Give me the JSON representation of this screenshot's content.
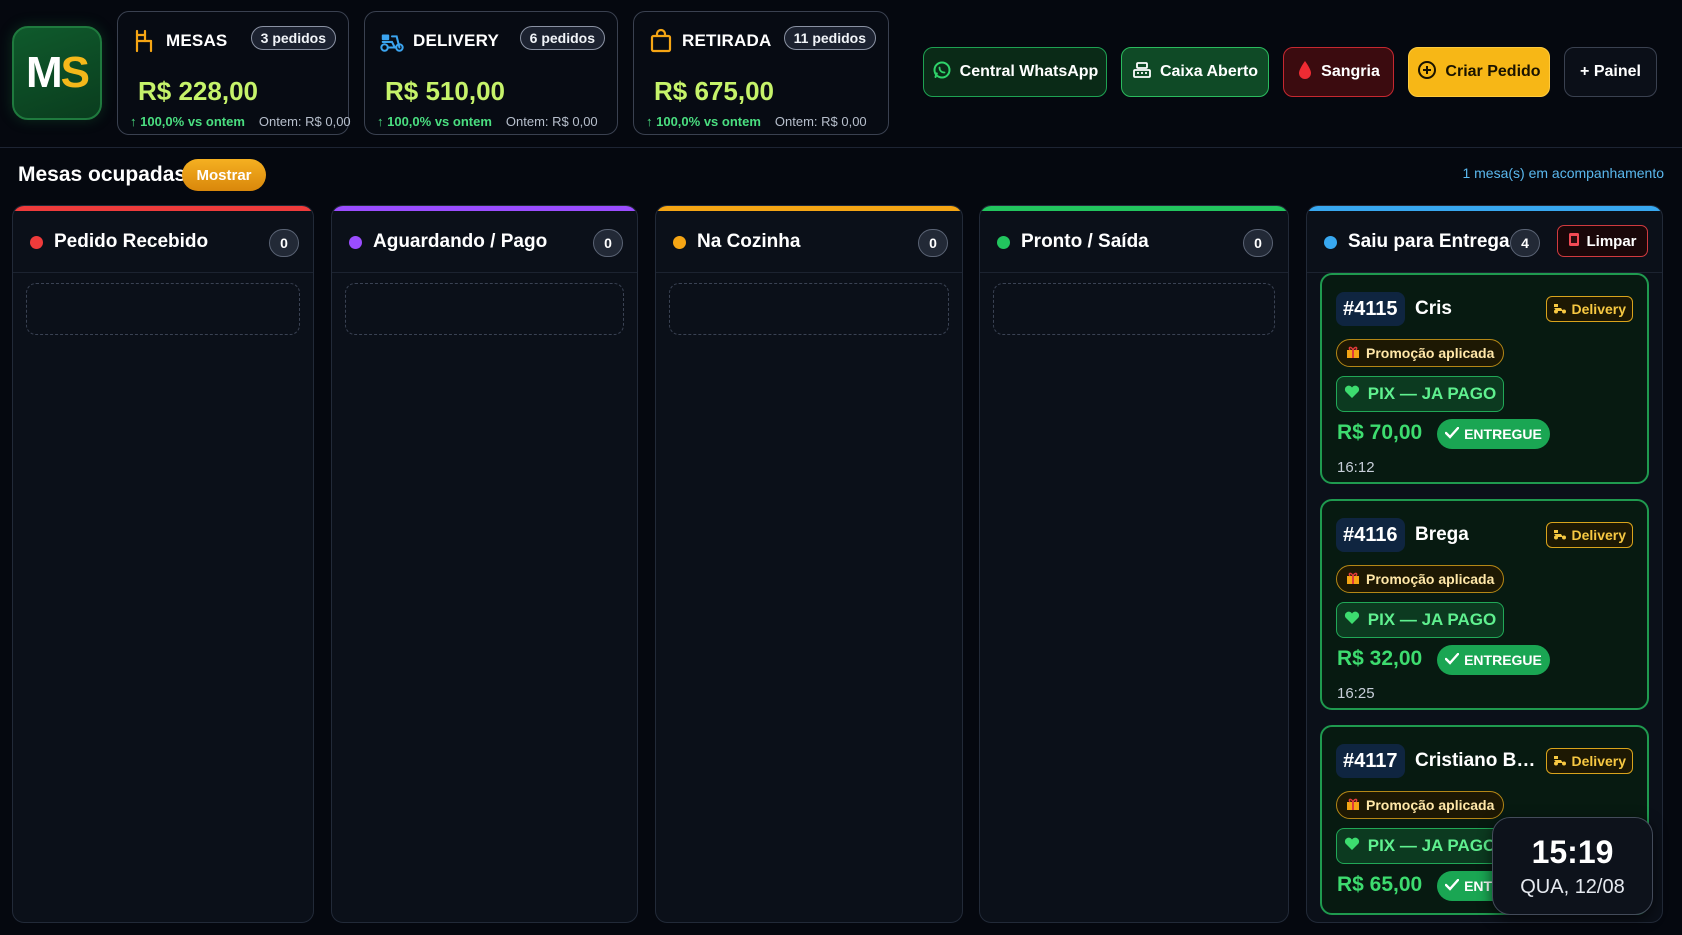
{
  "brand": {
    "logo_m": "M",
    "logo_s": "S"
  },
  "stats": [
    {
      "icon": "chair-icon",
      "title": "MESAS",
      "badge": "3 pedidos",
      "value": "R$ 228,00",
      "trend": "↑ 100,0% vs ontem",
      "yesterday": "Ontem: R$ 0,00"
    },
    {
      "icon": "scooter-icon",
      "title": "DELIVERY",
      "badge": "6 pedidos",
      "value": "R$ 510,00",
      "trend": "↑ 100,0% vs ontem",
      "yesterday": "Ontem: R$ 0,00"
    },
    {
      "icon": "bag-icon",
      "title": "RETIRADA",
      "badge": "11 pedidos",
      "value": "R$ 675,00",
      "trend": "↑ 100,0% vs ontem",
      "yesterday": "Ontem: R$ 0,00"
    }
  ],
  "actions": {
    "whatsapp": "Central WhatsApp",
    "caixa": "Caixa Aberto",
    "sangria": "Sangria",
    "criar": "Criar Pedido",
    "painel": "+ Painel"
  },
  "subbar": {
    "title": "Mesas ocupadas",
    "toggle": "Mostrar",
    "tracking": "1 mesa(s) em acompanhamento"
  },
  "columns": [
    {
      "title": "Pedido Recebido",
      "count": "0",
      "color": "#ef3b3b"
    },
    {
      "title": "Aguardando / Pago",
      "count": "0",
      "color": "#9b4dff"
    },
    {
      "title": "Na Cozinha",
      "count": "0",
      "color": "#f5a514"
    },
    {
      "title": "Pronto / Saída",
      "count": "0",
      "color": "#22c55e"
    },
    {
      "title": "Saiu para Entrega",
      "count": "4",
      "color": "#38a8f0",
      "clear_label": "Limpar"
    }
  ],
  "orders": [
    {
      "id": "#4115",
      "name": "Cris",
      "tag": "Delivery",
      "promo": "Promoção aplicada",
      "payment": "PIX — JA PAGO",
      "price": "R$ 70,00",
      "status": "ENTREGUE",
      "time": "16:12"
    },
    {
      "id": "#4116",
      "name": "Brega",
      "tag": "Delivery",
      "promo": "Promoção aplicada",
      "payment": "PIX — JA PAGO",
      "price": "R$ 32,00",
      "status": "ENTREGUE",
      "time": "16:25"
    },
    {
      "id": "#4117",
      "name": "Cristiano Ba...",
      "tag": "Delivery",
      "promo": "Promoção aplicada",
      "payment": "PIX — JA PAGO",
      "price": "R$ 65,00",
      "status": "ENTREGUE",
      "time": ""
    }
  ],
  "clock": {
    "time": "15:19",
    "date": "QUA, 12/08"
  }
}
